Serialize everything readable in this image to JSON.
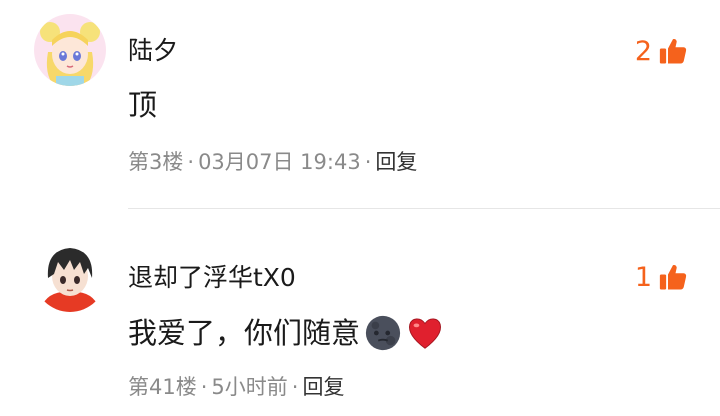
{
  "comments": [
    {
      "username": "陆夕",
      "likes": "2",
      "text": "顶",
      "floor": "第3楼",
      "time": "03月07日 19:43",
      "reply": "回复",
      "avatar": "anime-girl-avatar"
    },
    {
      "username": "退却了浮华tX0",
      "likes": "1",
      "text": "我爱了，你们随意",
      "emojis": [
        "moon-face-emoji",
        "red-heart-emoji"
      ],
      "floor": "第41楼",
      "time": "5小时前",
      "reply": "回复",
      "avatar": "anime-boy-avatar"
    }
  ],
  "colors": {
    "accent": "#f5621c",
    "meta": "#8a8a8a",
    "text": "#1a1a1a"
  },
  "icons": {
    "like": "thumbs-up-icon"
  },
  "separator": "·"
}
